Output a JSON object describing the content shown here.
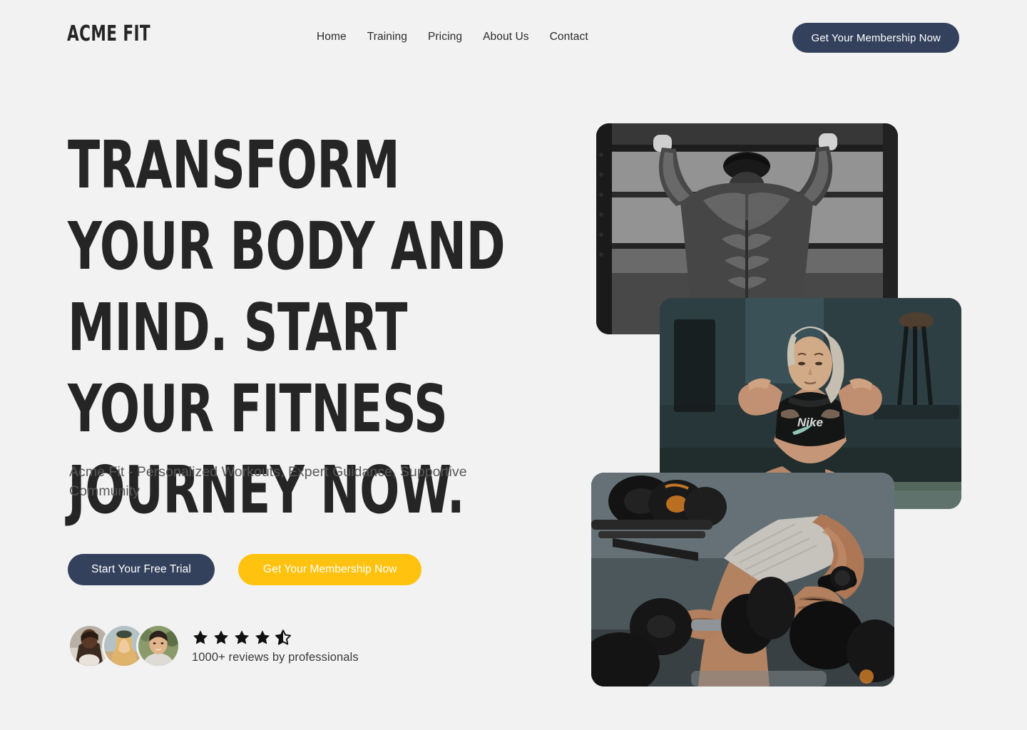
{
  "brand": {
    "logo": "ACME FIT"
  },
  "nav": {
    "items": [
      {
        "label": "Home"
      },
      {
        "label": "Training"
      },
      {
        "label": "Pricing"
      },
      {
        "label": "About Us"
      },
      {
        "label": "Contact"
      }
    ],
    "cta_label": "Get Your Membership Now"
  },
  "hero": {
    "headline": "Transform your body and mind. Start your fitness journey now.",
    "subheadline": "Acme Fit - Personalized Workouts, Expert Guidance, Supportive Community",
    "primary_cta": "Start Your Free Trial",
    "secondary_cta": "Get Your Membership Now"
  },
  "social_proof": {
    "rating": 4.5,
    "max_rating": 5,
    "reviews_text": "1000+ reviews by professionals",
    "avatars": [
      {
        "name": "avatar-athlete-1"
      },
      {
        "name": "avatar-athlete-2"
      },
      {
        "name": "avatar-athlete-3"
      }
    ]
  },
  "gallery": {
    "images": [
      {
        "name": "pull-up-athlete",
        "caption": "Muscular man doing pull-ups on a bar, black and white"
      },
      {
        "name": "sit-up-athlete",
        "caption": "Blonde woman performing sit-ups in a gym"
      },
      {
        "name": "dumbbell-athlete",
        "caption": "Man lifting dumbbells from a rack"
      }
    ]
  },
  "colors": {
    "background": "#f2f2f2",
    "navy": "#33415c",
    "amber": "#ffc20e",
    "ink": "#252525",
    "muted": "#58585b"
  }
}
